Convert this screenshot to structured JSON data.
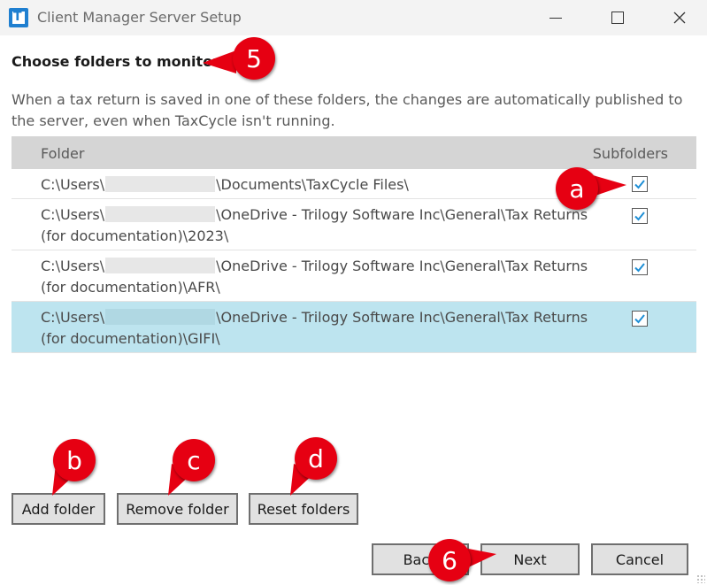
{
  "window": {
    "title": "Client Manager Server Setup"
  },
  "heading": "Choose folders to monitor",
  "description": "When a tax return is saved in one of these folders, the changes are automatically published to the server, even when TaxCycle isn't running.",
  "table": {
    "col_folder": "Folder",
    "col_subfolders": "Subfolders",
    "rows": [
      {
        "prefix": "C:\\Users\\",
        "suffix": "\\Documents\\TaxCycle Files\\",
        "line2": "",
        "subfolders": true,
        "selected": false
      },
      {
        "prefix": "C:\\Users\\",
        "suffix": "\\OneDrive - Trilogy Software Inc\\General\\Tax Returns",
        "line2": "(for documentation)\\2023\\",
        "subfolders": true,
        "selected": false
      },
      {
        "prefix": "C:\\Users\\",
        "suffix": "\\OneDrive - Trilogy Software Inc\\General\\Tax Returns",
        "line2": "(for documentation)\\AFR\\",
        "subfolders": true,
        "selected": false
      },
      {
        "prefix": "C:\\Users\\",
        "suffix": "\\OneDrive - Trilogy Software Inc\\General\\Tax Returns",
        "line2": "(for documentation)\\GIFI\\",
        "subfolders": true,
        "selected": true
      }
    ]
  },
  "buttons": {
    "add_folder": "Add folder",
    "remove_folder": "Remove folder",
    "reset_folders": "Reset folders",
    "back": "Back",
    "next": "Next",
    "cancel": "Cancel"
  },
  "callouts": {
    "step5": "5",
    "a": "a",
    "b": "b",
    "c": "c",
    "d": "d",
    "step6": "6"
  },
  "colors": {
    "callout": "#e60012",
    "selected_row": "#bde4ef",
    "header_bg": "#d5d5d5",
    "check": "#1f8fd6"
  }
}
